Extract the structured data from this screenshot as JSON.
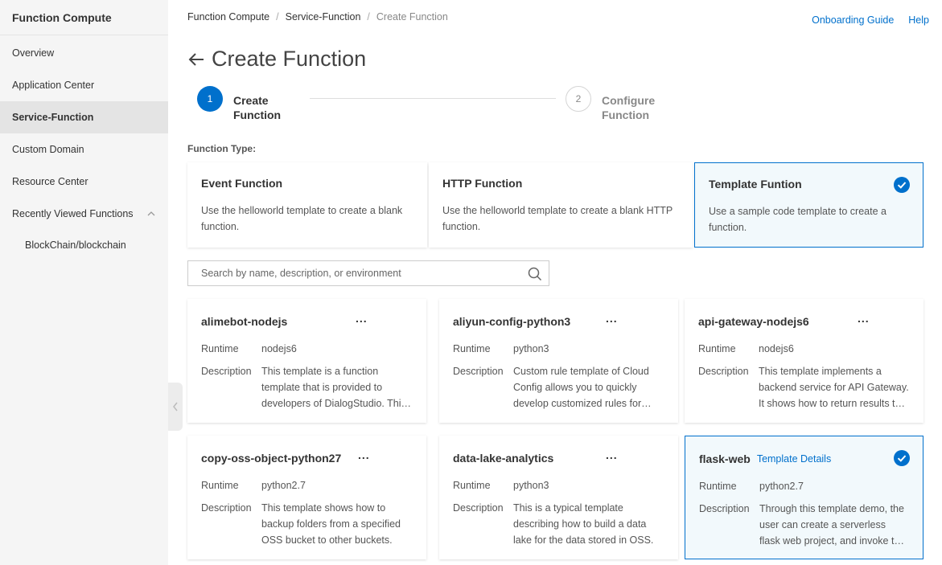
{
  "sidebar": {
    "title": "Function Compute",
    "items": [
      {
        "label": "Overview"
      },
      {
        "label": "Application Center"
      },
      {
        "label": "Service-Function"
      },
      {
        "label": "Custom Domain"
      },
      {
        "label": "Resource Center"
      },
      {
        "label": "Recently Viewed Functions"
      }
    ],
    "recent": [
      {
        "label": "BlockChain/blockchain"
      }
    ]
  },
  "header": {
    "breadcrumb": [
      "Function Compute",
      "Service-Function",
      "Create Function"
    ],
    "links": {
      "onboarding": "Onboarding Guide",
      "help": "Help"
    }
  },
  "page": {
    "title": "Create Function",
    "steps": [
      {
        "number": "1",
        "label": "Create Function"
      },
      {
        "number": "2",
        "label": "Configure Function"
      }
    ],
    "function_type_label": "Function Type:",
    "function_types": [
      {
        "title": "Event Function",
        "desc": "Use the helloworld template to create a blank function."
      },
      {
        "title": "HTTP Function",
        "desc": "Use the helloworld template to create a blank HTTP function."
      },
      {
        "title": "Template Funtion",
        "desc": "Use a sample code template to create a function."
      }
    ],
    "search": {
      "placeholder": "Search by name, description, or environment",
      "value": ""
    },
    "labels": {
      "runtime": "Runtime",
      "description": "Description",
      "more": "...",
      "details": "Template Details"
    },
    "templates": [
      {
        "name": "alimebot-nodejs",
        "runtime": "nodejs6",
        "desc": "This template is a function template that is provided to developers of DialogStudio. This template can be used for quick development."
      },
      {
        "name": "aliyun-config-python3",
        "runtime": "python3",
        "desc": "Custom rule template of Cloud Config allows you to quickly develop customized rules for auditing resources."
      },
      {
        "name": "api-gateway-nodejs6",
        "runtime": "nodejs6",
        "desc": "This template implements a backend service for API Gateway. It shows how to return results to API Gateway."
      },
      {
        "name": "copy-oss-object-python27",
        "runtime": "python2.7",
        "desc": "This template shows how to backup folders from a specified OSS bucket to other buckets."
      },
      {
        "name": "data-lake-analytics",
        "runtime": "python3",
        "desc": "This is a typical template describing how to build a data lake for the data stored in OSS."
      },
      {
        "name": "flask-web",
        "runtime": "python2.7",
        "desc": "Through this template demo, the user can create a serverless flask web project, and invoke the function through HTTP."
      }
    ]
  },
  "colors": {
    "accent": "#0070cc",
    "selected_bg": "#f2f9fc",
    "sidebar_bg": "#f5f5f5"
  }
}
